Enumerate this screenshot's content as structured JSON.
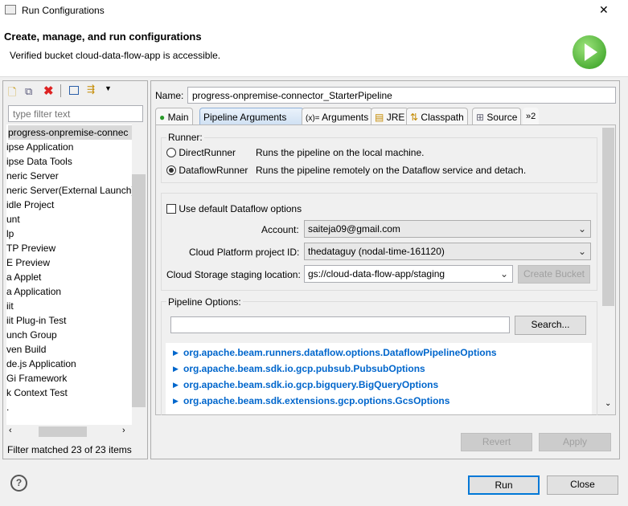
{
  "window": {
    "title": "Run Configurations",
    "close": "✕"
  },
  "header": {
    "title": "Create, manage, and run configurations",
    "message": "Verified bucket cloud-data-flow-app is accessible."
  },
  "left": {
    "filter_placeholder": "type filter text",
    "items": [
      "progress-onpremise-connec",
      "ipse Application",
      "ipse Data Tools",
      "neric Server",
      "neric Server(External Launch)",
      "idle Project",
      "unt",
      "lp",
      "TP Preview",
      "E Preview",
      "a Applet",
      "a Application",
      "iit",
      "iit Plug-in Test",
      "unch Group",
      "ven Build",
      "de.js Application",
      "Gi Framework",
      "k Context Test",
      "."
    ],
    "status": "Filter matched 23 of 23 items"
  },
  "name": {
    "label": "Name:",
    "value": "progress-onpremise-connector_StarterPipeline"
  },
  "tabs": [
    "Main",
    "Pipeline Arguments",
    "Arguments",
    "JRE",
    "Classpath",
    "Source",
    "»2"
  ],
  "runner": {
    "label": "Runner:",
    "options": [
      {
        "name": "DirectRunner",
        "desc": "Runs the pipeline on the local machine."
      },
      {
        "name": "DataflowRunner",
        "desc": "Runs the pipeline remotely on the Dataflow service and detach."
      }
    ]
  },
  "dataflow": {
    "use_default": "Use default Dataflow options",
    "account_label": "Account:",
    "account": "saiteja09@gmail.com",
    "project_label": "Cloud Platform project ID:",
    "project": "thedataguy (nodal-time-161120)",
    "staging_label": "Cloud Storage staging location:",
    "staging": "gs://cloud-data-flow-app/staging",
    "create_bucket": "Create Bucket"
  },
  "pipeline": {
    "label": "Pipeline Options:",
    "search": "Search...",
    "options": [
      "org.apache.beam.runners.dataflow.options.DataflowPipelineOptions",
      "org.apache.beam.sdk.io.gcp.pubsub.PubsubOptions",
      "org.apache.beam.sdk.io.gcp.bigquery.BigQueryOptions",
      "org.apache.beam.sdk.extensions.gcp.options.GcsOptions"
    ]
  },
  "buttons": {
    "revert": "Revert",
    "apply": "Apply",
    "run": "Run",
    "close": "Close",
    "help": "?"
  }
}
